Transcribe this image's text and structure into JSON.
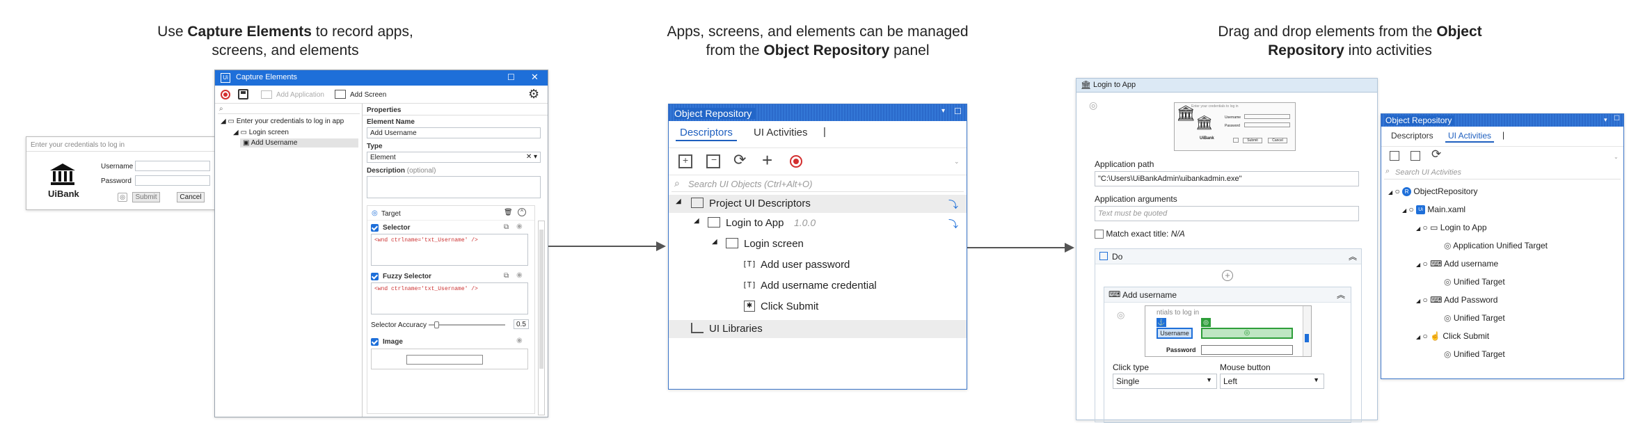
{
  "captions": {
    "left": {
      "pre": "Use ",
      "bold": "Capture Elements",
      "post": " to record apps, screens, and elements"
    },
    "middle": {
      "pre": "Apps, screens, and elements can be managed from the ",
      "bold": "Object Repository",
      "post": " panel"
    },
    "right": {
      "pre": "Drag and drop elements from the ",
      "bold": "Object Repository",
      "post": " into activities"
    }
  },
  "uibank_login": {
    "hint": "Enter your credentials to log in",
    "logo_text": "UiBank",
    "username_label": "Username",
    "password_label": "Password",
    "submit_label": "Submit",
    "cancel_label": "Cancel"
  },
  "capture": {
    "title": "Capture Elements",
    "add_application": "Add Application",
    "add_screen": "Add Screen",
    "tree": [
      "Enter your credentials to log in app",
      "Login screen",
      "Add Username"
    ],
    "properties_header": "Properties",
    "element_name_label": "Element Name",
    "element_name_value": "Add Username",
    "type_label": "Type",
    "type_value": "Element",
    "description_label": "Description",
    "description_optional": "(optional)",
    "target_label": "Target",
    "selector_label": "Selector",
    "selector_code": "<wnd ctrlname='txt_Username' />",
    "fuzzy_label": "Fuzzy Selector",
    "fuzzy_code": "<wnd ctrlname='txt_Username' />",
    "accuracy_label": "Selector Accuracy",
    "accuracy_value": "0.5",
    "image_label": "Image"
  },
  "or_main": {
    "title": "Object Repository",
    "tab_descriptors": "Descriptors",
    "tab_activities": "UI Activities",
    "search_placeholder": "Search UI Objects (Ctrl+Alt+O)",
    "tree": {
      "project": "Project UI Descriptors",
      "app": "Login to App",
      "app_version": "1.0.0",
      "screen": "Login screen",
      "el1": "Add user password",
      "el2": "Add username credential",
      "el3": "Click Submit",
      "libraries": "UI Libraries"
    }
  },
  "activity": {
    "title": "Login to App",
    "app_path_label": "Application path",
    "app_path_value": "\"C:\\Users\\UiBankAdmin\\uibankadmin.exe\"",
    "app_args_label": "Application arguments",
    "app_args_placeholder": "Text must be quoted",
    "match_label": "Match exact title:",
    "match_value": "N/A",
    "do_label": "Do",
    "add_username": "Add username",
    "preview_hint": "ntials to log in",
    "preview_user": "Username",
    "preview_pass": "Password",
    "click_type_label": "Click type",
    "click_type_value": "Single",
    "mouse_button_label": "Mouse button",
    "mouse_button_value": "Left",
    "thumb": {
      "hint": "Enter your credentials to log in",
      "user": "Username",
      "pass": "Password",
      "logo": "UiBank",
      "submit": "Submit",
      "cancel": "Cancel"
    }
  },
  "or_small": {
    "title": "Object Repository",
    "tab_descriptors": "Descriptors",
    "tab_activities": "UI Activities",
    "search_placeholder": "Search UI Activities",
    "tree": {
      "root": "ObjectRepository",
      "main": "Main.xaml",
      "login": "Login to App",
      "login_target": "Application Unified Target",
      "add_username": "Add username",
      "add_username_target": "Unified Target",
      "add_password": "Add Password",
      "add_password_target": "Unified Target",
      "click_submit": "Click Submit",
      "click_submit_target": "Unified Target"
    }
  },
  "colors": {
    "accent": "#1e6fd9",
    "record_red": "#d32f2f",
    "green": "#2e9e3a"
  }
}
